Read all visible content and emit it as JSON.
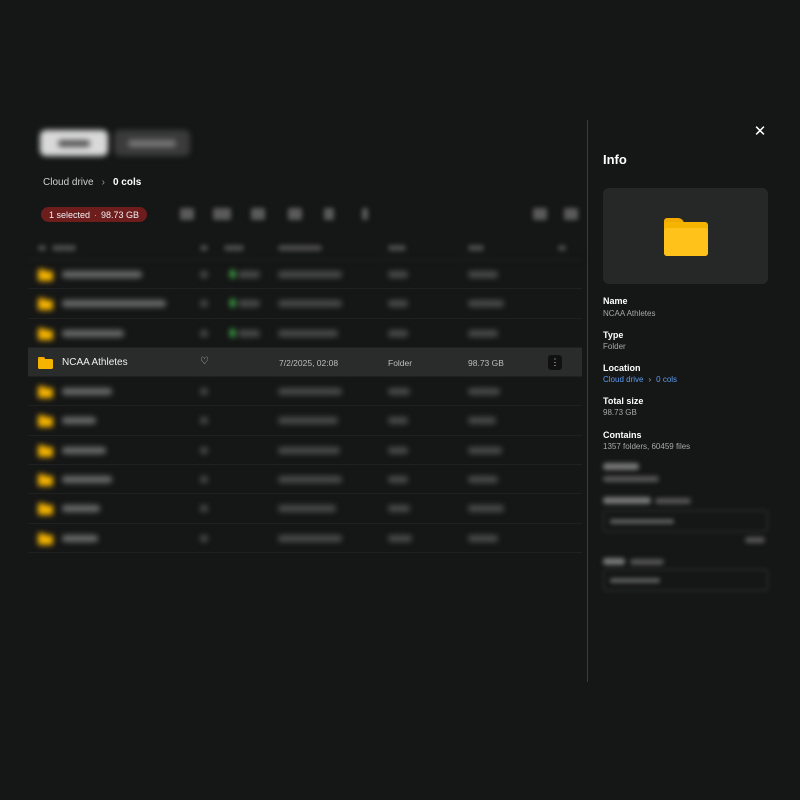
{
  "breadcrumb": {
    "root": "Cloud drive",
    "separator": "›",
    "current": "0 cols"
  },
  "selection": {
    "count": "1 selected",
    "dot": "·",
    "size": "98.73 GB"
  },
  "selected_row": {
    "name": "NCAA Athletes",
    "date_modified": "7/2/2025, 02:08",
    "type": "Folder",
    "size": "98.73 GB"
  },
  "info_panel": {
    "title": "Info",
    "close_icon": "close-icon",
    "name_label": "Name",
    "name_value": "NCAA Athletes",
    "type_label": "Type",
    "type_value": "Folder",
    "location_label": "Location",
    "location_root": "Cloud drive",
    "location_separator": "›",
    "location_current": "0 cols",
    "total_size_label": "Total size",
    "total_size_value": "98.73 GB",
    "contains_label": "Contains",
    "contains_value": "1357 folders, 60459 files"
  },
  "colors": {
    "background": "#151616",
    "accent_folder": "#f5b400",
    "link": "#5b9cf0",
    "selection_badge": "#6e1d1d"
  }
}
